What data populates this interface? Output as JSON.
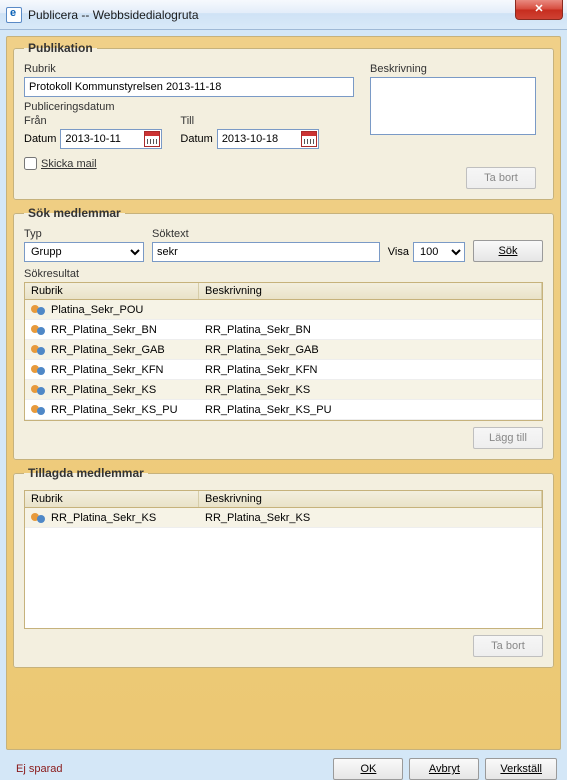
{
  "window": {
    "title": "Publicera -- Webbsidedialogruta",
    "close_glyph": "✕"
  },
  "publikation": {
    "legend": "Publikation",
    "rubrik_label": "Rubrik",
    "rubrik_value": "Protokoll Kommunstyrelsen 2013-11-18",
    "beskrivning_label": "Beskrivning",
    "beskrivning_value": "",
    "publiceringsdatum_label": "Publiceringsdatum",
    "fran_label": "Från",
    "till_label": "Till",
    "datum_label": "Datum",
    "fran_value": "2013-10-11",
    "till_value": "2013-10-18",
    "ta_bort_label": "Ta bort",
    "skicka_mail_label": "Skicka mail"
  },
  "sok": {
    "legend": "Sök medlemmar",
    "typ_label": "Typ",
    "typ_value": "Grupp",
    "soktext_label": "Söktext",
    "soktext_value": "sekr",
    "visa_label": "Visa",
    "visa_value": "100",
    "sok_button": "Sök",
    "sokresultat_label": "Sökresultat",
    "col_rubrik": "Rubrik",
    "col_beskrivning": "Beskrivning",
    "rows": [
      {
        "rubrik": "Platina_Sekr_POU",
        "beskrivning": ""
      },
      {
        "rubrik": "RR_Platina_Sekr_BN",
        "beskrivning": "RR_Platina_Sekr_BN"
      },
      {
        "rubrik": "RR_Platina_Sekr_GAB",
        "beskrivning": "RR_Platina_Sekr_GAB"
      },
      {
        "rubrik": "RR_Platina_Sekr_KFN",
        "beskrivning": "RR_Platina_Sekr_KFN"
      },
      {
        "rubrik": "RR_Platina_Sekr_KS",
        "beskrivning": "RR_Platina_Sekr_KS"
      },
      {
        "rubrik": "RR_Platina_Sekr_KS_PU",
        "beskrivning": "RR_Platina_Sekr_KS_PU"
      }
    ],
    "lagg_till_label": "Lägg till"
  },
  "tillagda": {
    "legend": "Tillagda medlemmar",
    "col_rubrik": "Rubrik",
    "col_beskrivning": "Beskrivning",
    "rows": [
      {
        "rubrik": "RR_Platina_Sekr_KS",
        "beskrivning": "RR_Platina_Sekr_KS"
      }
    ],
    "ta_bort_label": "Ta bort"
  },
  "footer": {
    "status": "Ej sparad",
    "ok": "OK",
    "avbryt": "Avbryt",
    "verkstall": "Verkställ"
  }
}
